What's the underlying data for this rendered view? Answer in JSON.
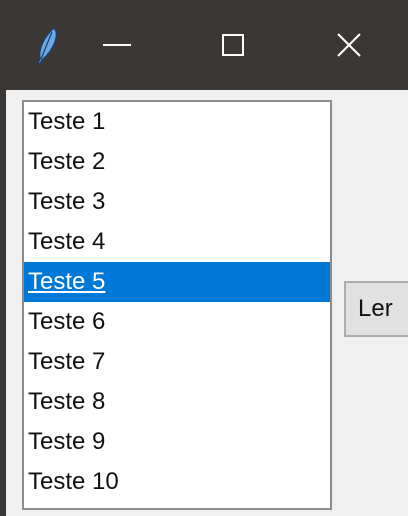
{
  "titlebar": {
    "app_icon": "feather-icon",
    "buttons": [
      "minimize-icon",
      "maximize-icon",
      "close-icon"
    ],
    "close_glyph": "✕",
    "background_color": "#3b3734"
  },
  "listbox": {
    "items": [
      "Teste 1",
      "Teste 2",
      "Teste 3",
      "Teste 4",
      "Teste 5",
      "Teste 6",
      "Teste 7",
      "Teste 8",
      "Teste 9",
      "Teste 10"
    ],
    "selected": "Teste 5",
    "selection_color": "#0078d7"
  },
  "read_button": {
    "label": "Ler"
  }
}
